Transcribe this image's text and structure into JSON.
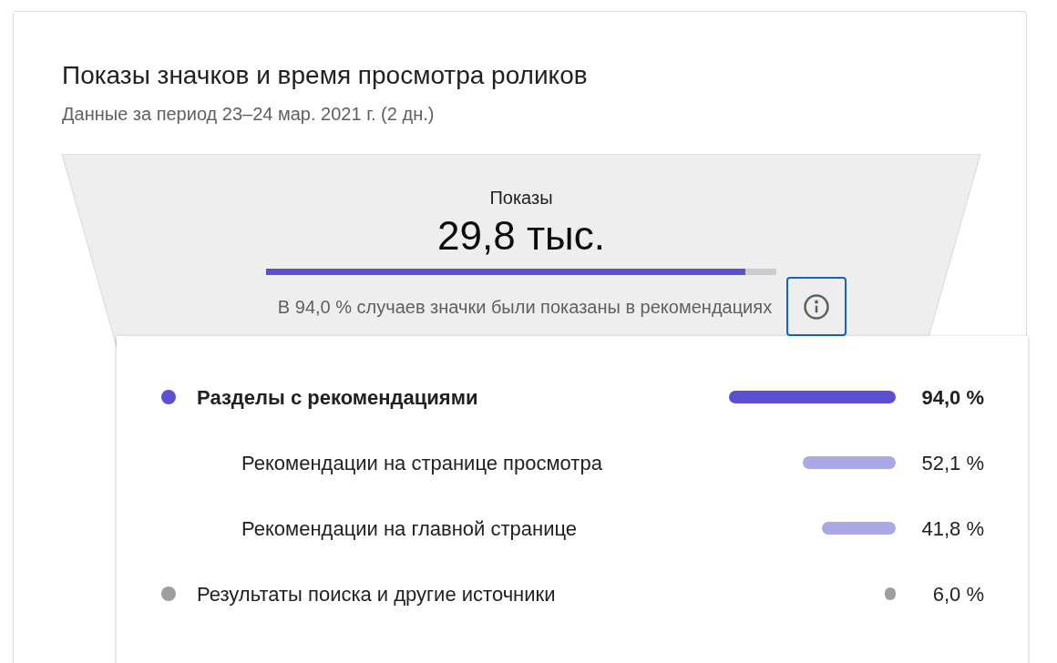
{
  "card": {
    "title": "Показы значков и время просмотра роликов",
    "subtitle": "Данные за период 23–24 мар. 2021 г. (2 дн.)"
  },
  "funnel": {
    "label": "Показы",
    "value": "29,8 тыс.",
    "level": 0.94,
    "caption": "В 94,0 % случаев значки были показаны в рекомендациях",
    "info_button": {
      "focused": true
    }
  },
  "sources": [
    {
      "label": "Разделы с рекомендациями",
      "percent": "94,0 %",
      "color": "#5b51d0",
      "expanded": true,
      "children": [
        {
          "label": "Рекомендации на странице просмотра",
          "percent": "52,1 %",
          "color": "#aba8e6"
        },
        {
          "label": "Рекомендации на главной странице",
          "percent": "41,8 %",
          "color": "#aba8e6"
        }
      ]
    },
    {
      "label": "Результаты поиска и другие источники",
      "percent": "6,0 %",
      "color": "#9e9e9e",
      "expanded": false
    }
  ]
}
